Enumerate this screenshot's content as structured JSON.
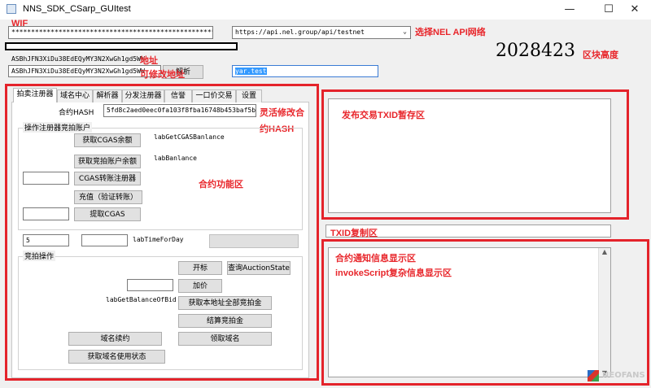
{
  "window": {
    "title": "NNS_SDK_CSarp_GUItest",
    "minimize": "—",
    "maximize": "☐",
    "close": "✕"
  },
  "wif": {
    "annotation": "WIF",
    "value": "********************************************************"
  },
  "network": {
    "selected": "https://api.nel.group/api/testnet",
    "annotation": "选择NEL API网络"
  },
  "block": {
    "height": "2028423",
    "annotation": "区块高度"
  },
  "address": {
    "label_value": "ASBhJFN3XiDu38EdEQyMY3N2XwGh1gd5WW",
    "annotation": "地址",
    "input_value": "ASBhJFN3XiDu38EdEQyMY3N2XwGh1gd5WW",
    "edit_annotation": "可修改地址",
    "resolve_button": "解析",
    "domain_input": "yar.test"
  },
  "tabs": [
    {
      "label": "拍卖注册器"
    },
    {
      "label": "域名中心"
    },
    {
      "label": "解析器"
    },
    {
      "label": "分发注册器"
    },
    {
      "label": "信誉"
    },
    {
      "label": "一口价交易"
    },
    {
      "label": "设置"
    }
  ],
  "contract": {
    "label": "合约HASH",
    "value": "5fd8c2aed0eec0fa103f8fba16748b453baf5b2e",
    "annotation_line1": "灵活修改合",
    "annotation_line2": "约HASH"
  },
  "registrar": {
    "group_title": "操作注册器竞拍账户",
    "get_cgas_button": "获取CGAS余额",
    "cgas_balance_label": "labGetCGASBanlance",
    "get_auction_balance_button": "获取竞拍账户余额",
    "balance_label": "labBanlance",
    "transfer_input": "",
    "transfer_button": "CGAS转账注册器",
    "topup_button": "充值（验证转账）",
    "withdraw_input": "",
    "withdraw_button": "提取CGAS",
    "area_annotation": "合约功能区"
  },
  "time": {
    "input1": "5",
    "input2": "",
    "label": "labTimeForDay",
    "box": ""
  },
  "auction": {
    "group_title": "竞拍操作",
    "start_button": "开标",
    "query_button": "查询AuctionState",
    "bid_input": "",
    "bid_button": "加价",
    "balance_label": "labGetBalanceOfBid",
    "get_all_button": "获取本地址全部竞拍金",
    "settle_button": "结算竞拍金",
    "renew_button": "域名续约",
    "claim_button": "领取域名",
    "status_button": "获取域名使用状态"
  },
  "txid_panel": {
    "annotation": "发布交易TXID暂存区",
    "content": ""
  },
  "txid_copy": {
    "annotation": "TXID复制区",
    "content": ""
  },
  "notify_panel": {
    "annotation_line1": "合约通知信息显示区",
    "annotation_line2": "invokeScript复杂信息显示区"
  },
  "watermark": {
    "text": "NEOFANS"
  }
}
